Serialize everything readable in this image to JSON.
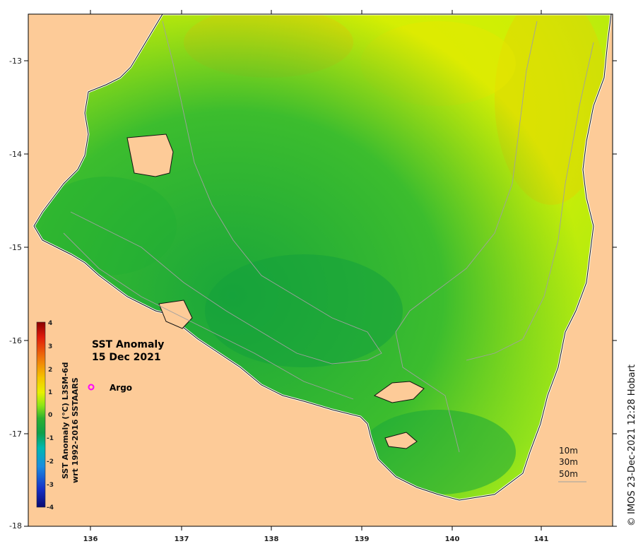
{
  "map": {
    "title_line1": "SST Anomaly",
    "title_line2": "15 Dec 2021",
    "x_ticks": [
      "136",
      "137",
      "138",
      "139",
      "140",
      "141"
    ],
    "y_ticks": [
      "-13",
      "-14",
      "-15",
      "-16",
      "-17",
      "-18"
    ],
    "legend": {
      "marker_label": "Argo",
      "marker_color": "#ff00ff"
    },
    "depth_labels": [
      "10m",
      "30m",
      "50m"
    ],
    "credit": "© IMOS 23-Dec-2021 12:28 Hobart",
    "land_color": "#fdcb98",
    "colors": {
      "cool": "#1aa63a",
      "neutral": "#7ee01b",
      "warm": "#d8f200",
      "hot": "#f5c400"
    }
  },
  "colorbar": {
    "ticks": [
      "4",
      "3",
      "2",
      "1",
      "0",
      "-1",
      "-2",
      "-3",
      "-4"
    ],
    "label_line1": "SST Anomaly (°C) L3SM-6d",
    "label_line2": "wrt 1992-2016 SSTAARS"
  }
}
